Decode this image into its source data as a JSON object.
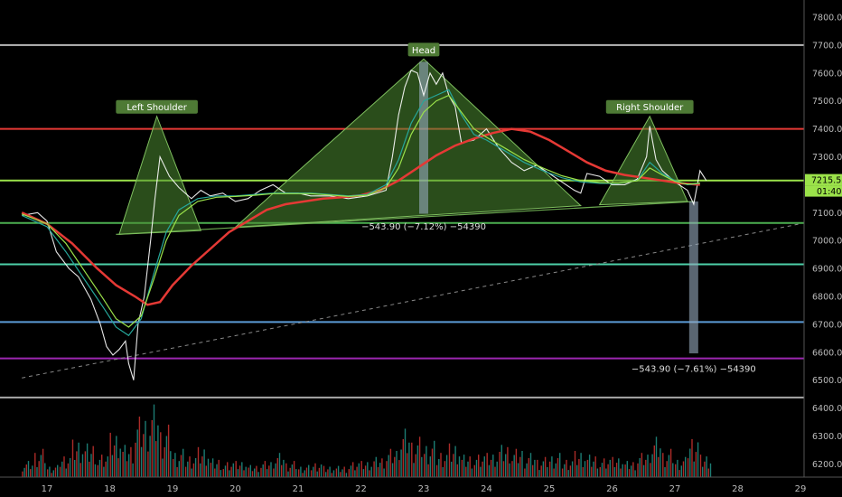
{
  "chart_data": {
    "type": "line",
    "title": "",
    "xlabel": "",
    "ylabel": "",
    "ylim": [
      6160,
      7860
    ],
    "xlim": [
      16.6,
      29.0
    ],
    "y_ticks": [
      "7800.00",
      "7700.00",
      "7600.00",
      "7500.00",
      "7400.00",
      "7300.00",
      "7200.00",
      "7100.00",
      "7000.00",
      "6900.00",
      "6800.00",
      "6700.00",
      "6600.00",
      "6500.00",
      "6400.00",
      "6300.00",
      "6200.00"
    ],
    "x_ticks": [
      "17",
      "18",
      "19",
      "20",
      "21",
      "22",
      "23",
      "24",
      "25",
      "26",
      "27",
      "28",
      "29"
    ],
    "last_price": "7215.53",
    "countdown": "01:40",
    "pattern_labels": [
      "Left Shoulder",
      "Head",
      "Right Shoulder"
    ],
    "measure_labels": [
      "−543.90 (−7.12%) −54390",
      "−543.90 (−7.61%) −54390"
    ],
    "horizontal_levels": [
      {
        "price": 7700,
        "color": "#b9b9b9"
      },
      {
        "price": 7400,
        "color": "#e53935"
      },
      {
        "price": 7215,
        "color": "#9be24a"
      },
      {
        "price": 7063,
        "color": "#4caf50"
      },
      {
        "price": 6915,
        "color": "#4dd0a8"
      },
      {
        "price": 6708,
        "color": "#5b9bd5"
      },
      {
        "price": 6578,
        "color": "#9c27b0"
      },
      {
        "price": 6438,
        "color": "#a8a8a8"
      }
    ],
    "trendline": {
      "from": [
        16.6,
        6508
      ],
      "to": [
        29.0,
        7060
      ],
      "style": "dashed"
    },
    "neckline": {
      "from": [
        18.1,
        7022
      ],
      "to": [
        27.3,
        7140
      ]
    },
    "pattern_triangles": [
      {
        "name": "Left Shoulder",
        "apex": [
          18.75,
          7445
        ],
        "base": [
          [
            18.15,
            7022
          ],
          [
            19.45,
            7036
          ]
        ]
      },
      {
        "name": "Head",
        "apex": [
          23.0,
          7650
        ],
        "base": [
          [
            20.0,
            7048
          ],
          [
            25.5,
            7125
          ]
        ]
      },
      {
        "name": "Right Shoulder",
        "apex": [
          26.6,
          7445
        ],
        "base": [
          [
            25.8,
            7128
          ],
          [
            27.2,
            7140
          ]
        ]
      }
    ],
    "measure_bars": [
      {
        "x": 23.0,
        "top": 7640,
        "bottom": 7096
      },
      {
        "x": 27.3,
        "top": 7140,
        "bottom": 6596
      }
    ],
    "series": [
      {
        "color": "#ffffff",
        "x": [
          16.6,
          16.85,
          17.0,
          17.15,
          17.35,
          17.5,
          17.7,
          17.85,
          17.95,
          18.05,
          18.15,
          18.25,
          18.3,
          18.38,
          18.45,
          18.55,
          18.65,
          18.72,
          18.8,
          18.95,
          19.1,
          19.3,
          19.45,
          19.6,
          19.8,
          20.0,
          20.2,
          20.4,
          20.6,
          20.8,
          21.0,
          21.2,
          21.5,
          21.8,
          22.1,
          22.4,
          22.5,
          22.6,
          22.7,
          22.8,
          22.9,
          23.0,
          23.1,
          23.2,
          23.3,
          23.4,
          23.5,
          23.6,
          23.8,
          24.0,
          24.2,
          24.4,
          24.6,
          24.8,
          25.0,
          25.2,
          25.4,
          25.5,
          25.6,
          25.8,
          26.0,
          26.2,
          26.4,
          26.55,
          26.6,
          26.7,
          26.8,
          27.0,
          27.2,
          27.3,
          27.4,
          27.5
        ],
        "values": [
          7090,
          7100,
          7070,
          6960,
          6900,
          6870,
          6790,
          6700,
          6620,
          6590,
          6610,
          6640,
          6560,
          6500,
          6700,
          6800,
          7000,
          7150,
          7300,
          7230,
          7190,
          7150,
          7180,
          7160,
          7170,
          7140,
          7150,
          7180,
          7200,
          7170,
          7170,
          7160,
          7160,
          7150,
          7160,
          7180,
          7300,
          7450,
          7550,
          7610,
          7600,
          7520,
          7600,
          7560,
          7600,
          7520,
          7480,
          7350,
          7360,
          7400,
          7330,
          7280,
          7250,
          7270,
          7240,
          7210,
          7180,
          7170,
          7240,
          7230,
          7200,
          7200,
          7220,
          7300,
          7410,
          7290,
          7250,
          7210,
          7180,
          7130,
          7250,
          7215
        ]
      },
      {
        "color": "#e53935",
        "x": [
          16.6,
          17.0,
          17.4,
          17.8,
          18.1,
          18.4,
          18.6,
          18.8,
          19.0,
          19.3,
          19.6,
          19.9,
          20.2,
          20.5,
          20.8,
          21.1,
          21.4,
          21.7,
          22.0,
          22.3,
          22.6,
          22.9,
          23.2,
          23.5,
          23.8,
          24.1,
          24.4,
          24.7,
          25.0,
          25.3,
          25.6,
          25.9,
          26.2,
          26.5,
          26.8,
          27.1,
          27.4
        ],
        "values": [
          7100,
          7060,
          6990,
          6900,
          6840,
          6800,
          6770,
          6780,
          6840,
          6910,
          6970,
          7030,
          7070,
          7110,
          7130,
          7140,
          7150,
          7155,
          7162,
          7180,
          7215,
          7260,
          7305,
          7340,
          7365,
          7385,
          7400,
          7390,
          7360,
          7320,
          7280,
          7250,
          7235,
          7225,
          7215,
          7205,
          7200
        ]
      },
      {
        "color": "#26a69a",
        "x": [
          16.6,
          17.0,
          17.3,
          17.6,
          17.9,
          18.1,
          18.3,
          18.5,
          18.7,
          18.9,
          19.1,
          19.4,
          19.7,
          20.0,
          20.3,
          20.6,
          20.9,
          21.2,
          21.5,
          21.8,
          22.1,
          22.4,
          22.6,
          22.8,
          23.0,
          23.2,
          23.4,
          23.6,
          23.8,
          24.0,
          24.3,
          24.6,
          24.9,
          25.2,
          25.5,
          25.8,
          26.1,
          26.4,
          26.6,
          26.8,
          27.0,
          27.2,
          27.4
        ],
        "values": [
          7090,
          7050,
          6960,
          6860,
          6760,
          6690,
          6660,
          6720,
          6880,
          7030,
          7110,
          7150,
          7160,
          7160,
          7165,
          7170,
          7170,
          7170,
          7165,
          7160,
          7165,
          7200,
          7290,
          7420,
          7500,
          7520,
          7540,
          7450,
          7380,
          7360,
          7320,
          7280,
          7250,
          7225,
          7210,
          7205,
          7205,
          7215,
          7280,
          7240,
          7215,
          7200,
          7205
        ]
      },
      {
        "color": "#9be24a",
        "x": [
          16.6,
          17.0,
          17.3,
          17.6,
          17.9,
          18.1,
          18.3,
          18.5,
          18.7,
          18.9,
          19.1,
          19.4,
          19.7,
          20.0,
          20.3,
          20.6,
          20.9,
          21.2,
          21.5,
          21.8,
          22.1,
          22.4,
          22.6,
          22.8,
          23.0,
          23.2,
          23.4,
          23.6,
          23.8,
          24.0,
          24.3,
          24.6,
          24.9,
          25.2,
          25.5,
          25.8,
          26.1,
          26.4,
          26.6,
          26.8,
          27.0,
          27.2,
          27.4
        ],
        "values": [
          7095,
          7060,
          6990,
          6890,
          6790,
          6720,
          6690,
          6730,
          6860,
          7000,
          7090,
          7140,
          7155,
          7158,
          7162,
          7168,
          7168,
          7168,
          7163,
          7158,
          7162,
          7190,
          7260,
          7380,
          7460,
          7500,
          7520,
          7460,
          7400,
          7370,
          7330,
          7290,
          7260,
          7232,
          7215,
          7208,
          7206,
          7214,
          7260,
          7235,
          7212,
          7202,
          7206
        ]
      }
    ],
    "volume": {
      "x": [
        16.6,
        16.8,
        17.0,
        17.2,
        17.4,
        17.6,
        17.8,
        18.0,
        18.2,
        18.4,
        18.6,
        18.8,
        19.0,
        19.2,
        19.4,
        19.6,
        19.8,
        20.0,
        20.2,
        20.4,
        20.6,
        20.8,
        21.0,
        21.2,
        21.4,
        21.6,
        21.8,
        22.0,
        22.2,
        22.4,
        22.6,
        22.8,
        23.0,
        23.2,
        23.4,
        23.6,
        23.8,
        24.0,
        24.2,
        24.4,
        24.6,
        24.8,
        25.0,
        25.2,
        25.4,
        25.6,
        25.8,
        26.0,
        26.2,
        26.4,
        26.6,
        26.8,
        27.0,
        27.2,
        27.4
      ],
      "values": [
        0.2,
        0.35,
        0.15,
        0.3,
        0.5,
        0.45,
        0.3,
        0.55,
        0.4,
        0.75,
        0.9,
        0.65,
        0.35,
        0.3,
        0.4,
        0.25,
        0.2,
        0.2,
        0.15,
        0.2,
        0.3,
        0.2,
        0.15,
        0.2,
        0.15,
        0.15,
        0.2,
        0.2,
        0.25,
        0.35,
        0.6,
        0.5,
        0.45,
        0.35,
        0.45,
        0.3,
        0.3,
        0.3,
        0.4,
        0.35,
        0.3,
        0.25,
        0.3,
        0.25,
        0.35,
        0.3,
        0.25,
        0.25,
        0.2,
        0.3,
        0.5,
        0.35,
        0.25,
        0.55,
        0.3
      ]
    }
  }
}
